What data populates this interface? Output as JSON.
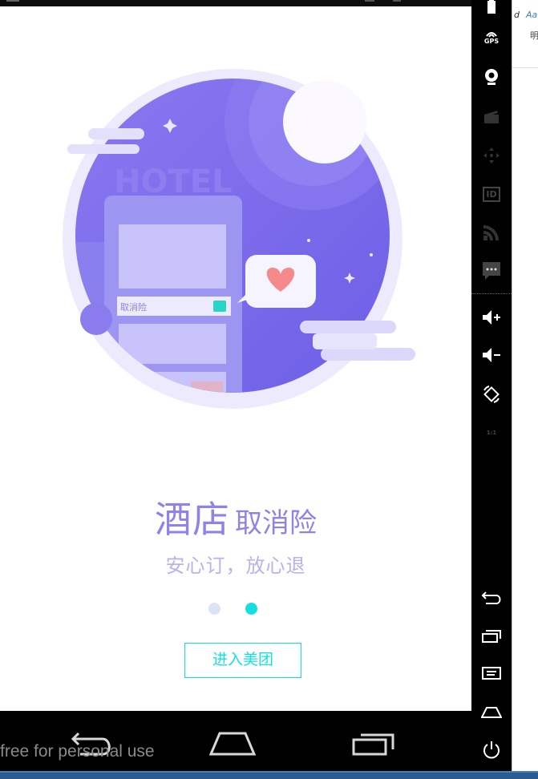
{
  "onboarding": {
    "headline_big": "酒店",
    "headline_small": "取消险",
    "subheadline": "安心订，放心退",
    "illustration": {
      "sign_text": "HOTEL",
      "card_label": "取消险",
      "colors": {
        "primary": "#7b68ee",
        "accent": "#14dfe0",
        "heart": "#f58a8a"
      }
    },
    "pager": {
      "total": 2,
      "active_index": 1
    },
    "enter_button_label": "进入美团"
  },
  "colors": {
    "accent": "#14dfe0",
    "headline": "#8f82e8",
    "subheadline": "#b8b2ee",
    "dot_inactive": "#dbe4f6"
  },
  "navbar": {
    "watermark": "free for personal use",
    "icons": [
      "back-icon",
      "home-icon",
      "recent-apps-icon"
    ]
  },
  "emulator_panel": {
    "gps_label": "GPS",
    "id_label": "ID",
    "scale_label": "1:1",
    "icons": [
      "battery-icon",
      "gps-icon",
      "camera-icon",
      "media-icon",
      "dpad-icon",
      "id-icon",
      "network-icon",
      "sms-icon",
      "volume-up-icon",
      "volume-down-icon",
      "rotate-icon",
      "scale-icon",
      "back-icon",
      "recent-apps-icon",
      "menu-icon",
      "home-icon",
      "power-icon"
    ]
  },
  "background_window": {
    "text_1": "Aa",
    "text_2": "明"
  }
}
